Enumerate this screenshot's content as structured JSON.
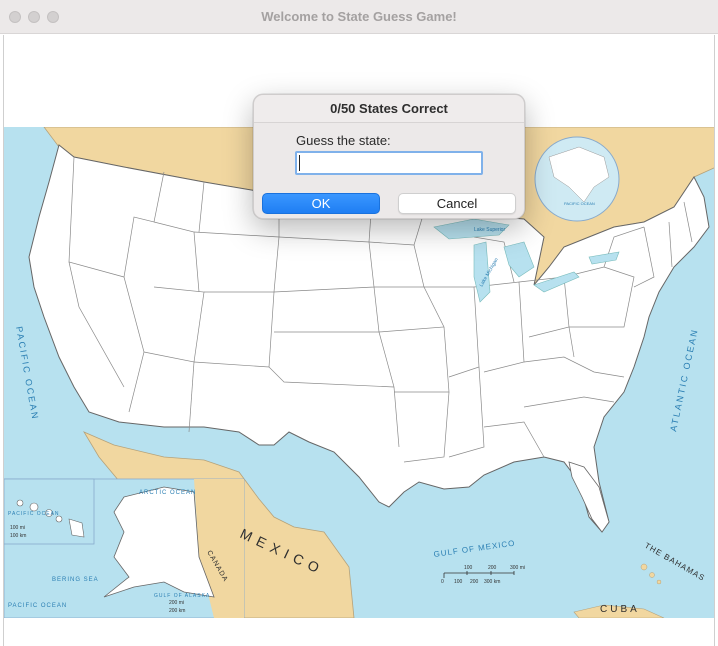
{
  "window": {
    "title": "Welcome to State Guess Game!"
  },
  "dialog": {
    "title": "0/50 States Correct",
    "prompt": "Guess the state:",
    "input_value": "",
    "ok_label": "OK",
    "cancel_label": "Cancel"
  },
  "map": {
    "labels": {
      "pacific_ocean": "PACIFIC OCEAN",
      "atlantic_ocean": "ATLANTIC OCEAN",
      "gulf_of_mexico": "GULF OF MEXICO",
      "mexico": "MEXICO",
      "the_bahamas": "THE BAHAMAS",
      "cuba": "CUBA",
      "canada": "CANADA",
      "arctic_ocean": "ARCTIC OCEAN",
      "bering_sea": "BERING SEA",
      "gulf_of_alaska": "GULF OF ALASKA",
      "pacific_ocean_inset": "PACIFIC OCEAN",
      "pacific_ocean_hawaii": "PACIFIC OCEAN",
      "pacific_ocean_globe": "PACIFIC OCEAN",
      "lake_superior": "Lake Superior",
      "lake_michigan": "Lake Michigan"
    },
    "scale_labels": {
      "mi_100": "100",
      "mi_200": "200",
      "mi_300": "300 mi",
      "km_100": "100",
      "km_200": "200",
      "km_300": "300 km",
      "zero": "0",
      "hawaii_mi": "100 mi",
      "hawaii_km": "100 km",
      "alaska_mi": "200 mi",
      "alaska_km": "200 km"
    },
    "colors": {
      "water": "#b7e1ef",
      "land_foreign": "#f1d7a0",
      "state_fill": "#ffffff",
      "border": "#8a8a8a",
      "label_blue": "#2b7fb3"
    }
  }
}
